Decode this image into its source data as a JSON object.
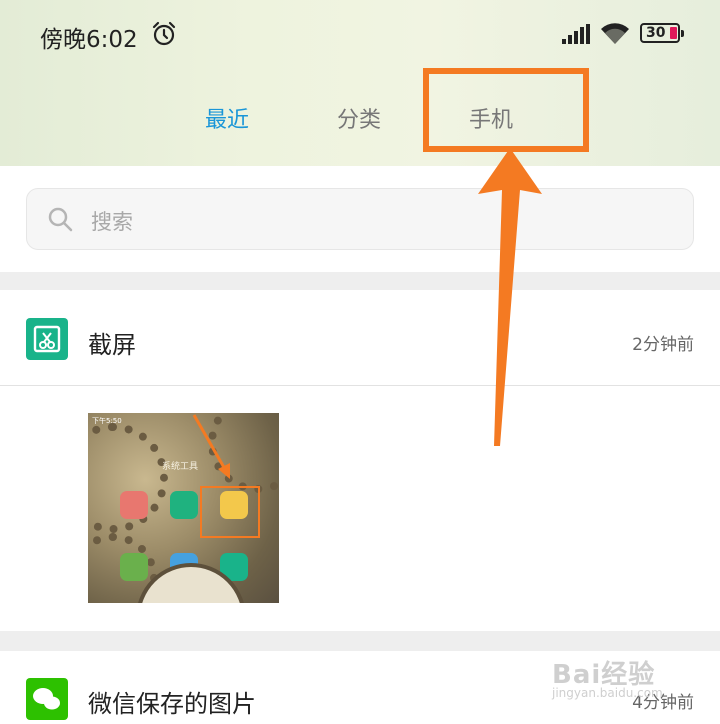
{
  "status_bar": {
    "time": "傍晚6:02",
    "battery_level": "30",
    "icons": [
      "alarm-icon",
      "signal-icon",
      "wifi-icon",
      "battery-icon"
    ]
  },
  "tabs": [
    {
      "label": "最近",
      "active": true
    },
    {
      "label": "分类",
      "active": false
    },
    {
      "label": "手机",
      "active": false
    }
  ],
  "search": {
    "placeholder": "搜索"
  },
  "sections": [
    {
      "title": "截屏",
      "time": "2分钟前",
      "icon": "screenshot-icon"
    },
    {
      "title": "微信保存的图片",
      "time": "4分钟前",
      "icon": "wechat-icon"
    }
  ],
  "thumbnail": {
    "status_text": "下午5:50",
    "folder_title": "系统工具"
  },
  "watermark": {
    "brand": "Bai经验",
    "url": "jingyan.baidu.com"
  },
  "colors": {
    "accent": "#1a96d8",
    "annotation": "#f47a22",
    "screenshot_icon": "#19b38a",
    "wechat_icon": "#2dc100",
    "battery_low": "#e0195a"
  }
}
